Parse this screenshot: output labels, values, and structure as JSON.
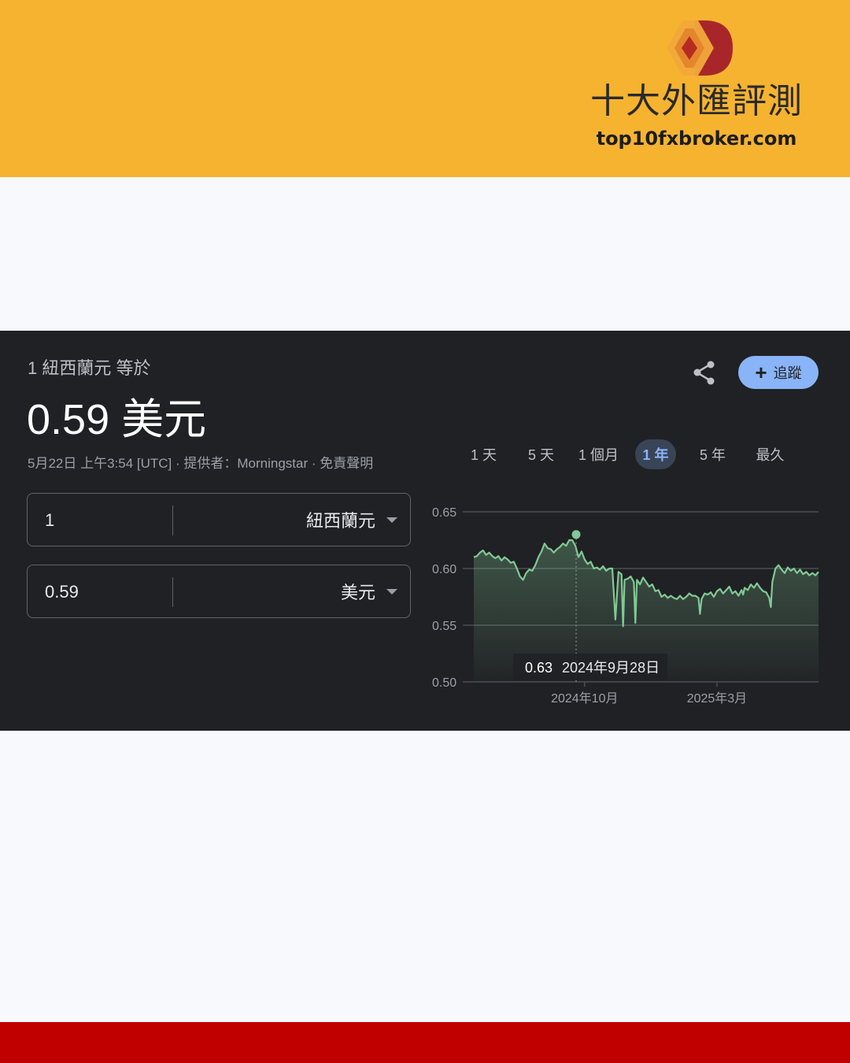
{
  "brand": {
    "name": "十大外匯評測",
    "url": "top10fxbroker.com"
  },
  "converter": {
    "equals_label": "1 紐西蘭元 等於",
    "result_value": "0.59 美元",
    "meta": "5月22日 上午3:54 [UTC] · 提供者：Morningstar · 免責聲明",
    "follow_label": "追蹤",
    "from": {
      "value": "1",
      "currency": "紐西蘭元"
    },
    "to": {
      "value": "0.59",
      "currency": "美元"
    }
  },
  "range_tabs": [
    "1 天",
    "5 天",
    "1 個月",
    "1 年",
    "5 年",
    "最久"
  ],
  "active_range": "1 年",
  "colors": {
    "accent": "#8ab4f8",
    "line": "#81c995",
    "panel_bg": "#202124",
    "top_band": "#f6b330",
    "bottom_band": "#c00000"
  },
  "chart_data": {
    "type": "area",
    "ylim": [
      0.5,
      0.65
    ],
    "yticks": [
      0.65,
      0.6,
      0.55,
      0.5
    ],
    "ytick_labels": [
      "0.65",
      "0.60",
      "0.55",
      "0.50"
    ],
    "xticks": [
      {
        "label": "2024年10月",
        "t": 0.36
      },
      {
        "label": "2025年3月",
        "t": 0.79
      }
    ],
    "series": [
      {
        "points": [
          [
            0.0,
            0.61
          ],
          [
            0.01,
            0.611
          ],
          [
            0.02,
            0.614
          ],
          [
            0.03,
            0.616
          ],
          [
            0.04,
            0.612
          ],
          [
            0.05,
            0.614
          ],
          [
            0.06,
            0.611
          ],
          [
            0.07,
            0.609
          ],
          [
            0.08,
            0.611
          ],
          [
            0.09,
            0.607
          ],
          [
            0.1,
            0.61
          ],
          [
            0.11,
            0.608
          ],
          [
            0.12,
            0.605
          ],
          [
            0.13,
            0.606
          ],
          [
            0.14,
            0.6
          ],
          [
            0.15,
            0.593
          ],
          [
            0.16,
            0.59
          ],
          [
            0.17,
            0.596
          ],
          [
            0.18,
            0.599
          ],
          [
            0.19,
            0.598
          ],
          [
            0.2,
            0.603
          ],
          [
            0.21,
            0.61
          ],
          [
            0.22,
            0.615
          ],
          [
            0.23,
            0.622
          ],
          [
            0.24,
            0.618
          ],
          [
            0.25,
            0.617
          ],
          [
            0.26,
            0.614
          ],
          [
            0.27,
            0.617
          ],
          [
            0.28,
            0.619
          ],
          [
            0.29,
            0.622
          ],
          [
            0.3,
            0.62
          ],
          [
            0.31,
            0.625
          ],
          [
            0.32,
            0.625
          ],
          [
            0.33,
            0.62
          ],
          [
            0.34,
            0.61
          ],
          [
            0.35,
            0.615
          ],
          [
            0.36,
            0.608
          ],
          [
            0.37,
            0.604
          ],
          [
            0.38,
            0.606
          ],
          [
            0.39,
            0.6
          ],
          [
            0.4,
            0.601
          ],
          [
            0.41,
            0.599
          ],
          [
            0.42,
            0.602
          ],
          [
            0.43,
            0.598
          ],
          [
            0.44,
            0.6
          ],
          [
            0.45,
            0.6
          ],
          [
            0.46,
            0.555
          ],
          [
            0.47,
            0.597
          ],
          [
            0.48,
            0.595
          ],
          [
            0.485,
            0.549
          ],
          [
            0.49,
            0.59
          ],
          [
            0.5,
            0.591
          ],
          [
            0.51,
            0.593
          ],
          [
            0.52,
            0.588
          ],
          [
            0.525,
            0.552
          ],
          [
            0.53,
            0.59
          ],
          [
            0.54,
            0.586
          ],
          [
            0.55,
            0.592
          ],
          [
            0.56,
            0.588
          ],
          [
            0.57,
            0.584
          ],
          [
            0.58,
            0.586
          ],
          [
            0.59,
            0.58
          ],
          [
            0.6,
            0.581
          ],
          [
            0.61,
            0.575
          ],
          [
            0.62,
            0.577
          ],
          [
            0.63,
            0.574
          ],
          [
            0.64,
            0.576
          ],
          [
            0.65,
            0.574
          ],
          [
            0.66,
            0.573
          ],
          [
            0.67,
            0.576
          ],
          [
            0.68,
            0.573
          ],
          [
            0.69,
            0.575
          ],
          [
            0.7,
            0.578
          ],
          [
            0.71,
            0.576
          ],
          [
            0.72,
            0.576
          ],
          [
            0.73,
            0.574
          ],
          [
            0.735,
            0.56
          ],
          [
            0.74,
            0.573
          ],
          [
            0.75,
            0.578
          ],
          [
            0.76,
            0.577
          ],
          [
            0.77,
            0.579
          ],
          [
            0.78,
            0.575
          ],
          [
            0.79,
            0.58
          ],
          [
            0.8,
            0.582
          ],
          [
            0.81,
            0.578
          ],
          [
            0.82,
            0.581
          ],
          [
            0.83,
            0.584
          ],
          [
            0.84,
            0.578
          ],
          [
            0.85,
            0.58
          ],
          [
            0.86,
            0.576
          ],
          [
            0.87,
            0.581
          ],
          [
            0.875,
            0.577
          ],
          [
            0.88,
            0.583
          ],
          [
            0.89,
            0.581
          ],
          [
            0.9,
            0.586
          ],
          [
            0.91,
            0.583
          ],
          [
            0.92,
            0.587
          ],
          [
            0.93,
            0.583
          ],
          [
            0.94,
            0.58
          ],
          [
            0.95,
            0.579
          ],
          [
            0.96,
            0.574
          ],
          [
            0.965,
            0.566
          ],
          [
            0.97,
            0.588
          ],
          [
            0.98,
            0.6
          ],
          [
            0.99,
            0.603
          ],
          [
            1.0,
            0.599
          ],
          [
            1.01,
            0.596
          ],
          [
            1.02,
            0.601
          ],
          [
            1.03,
            0.598
          ],
          [
            1.04,
            0.6
          ],
          [
            1.05,
            0.596
          ],
          [
            1.06,
            0.599
          ],
          [
            1.07,
            0.595
          ],
          [
            1.08,
            0.597
          ],
          [
            1.09,
            0.594
          ],
          [
            1.1,
            0.596
          ],
          [
            1.11,
            0.594
          ],
          [
            1.12,
            0.597
          ]
        ]
      }
    ],
    "marker": {
      "t": 0.3325,
      "value": 0.63,
      "value_label": "0.63",
      "date_label": "2024年9月28日"
    }
  }
}
